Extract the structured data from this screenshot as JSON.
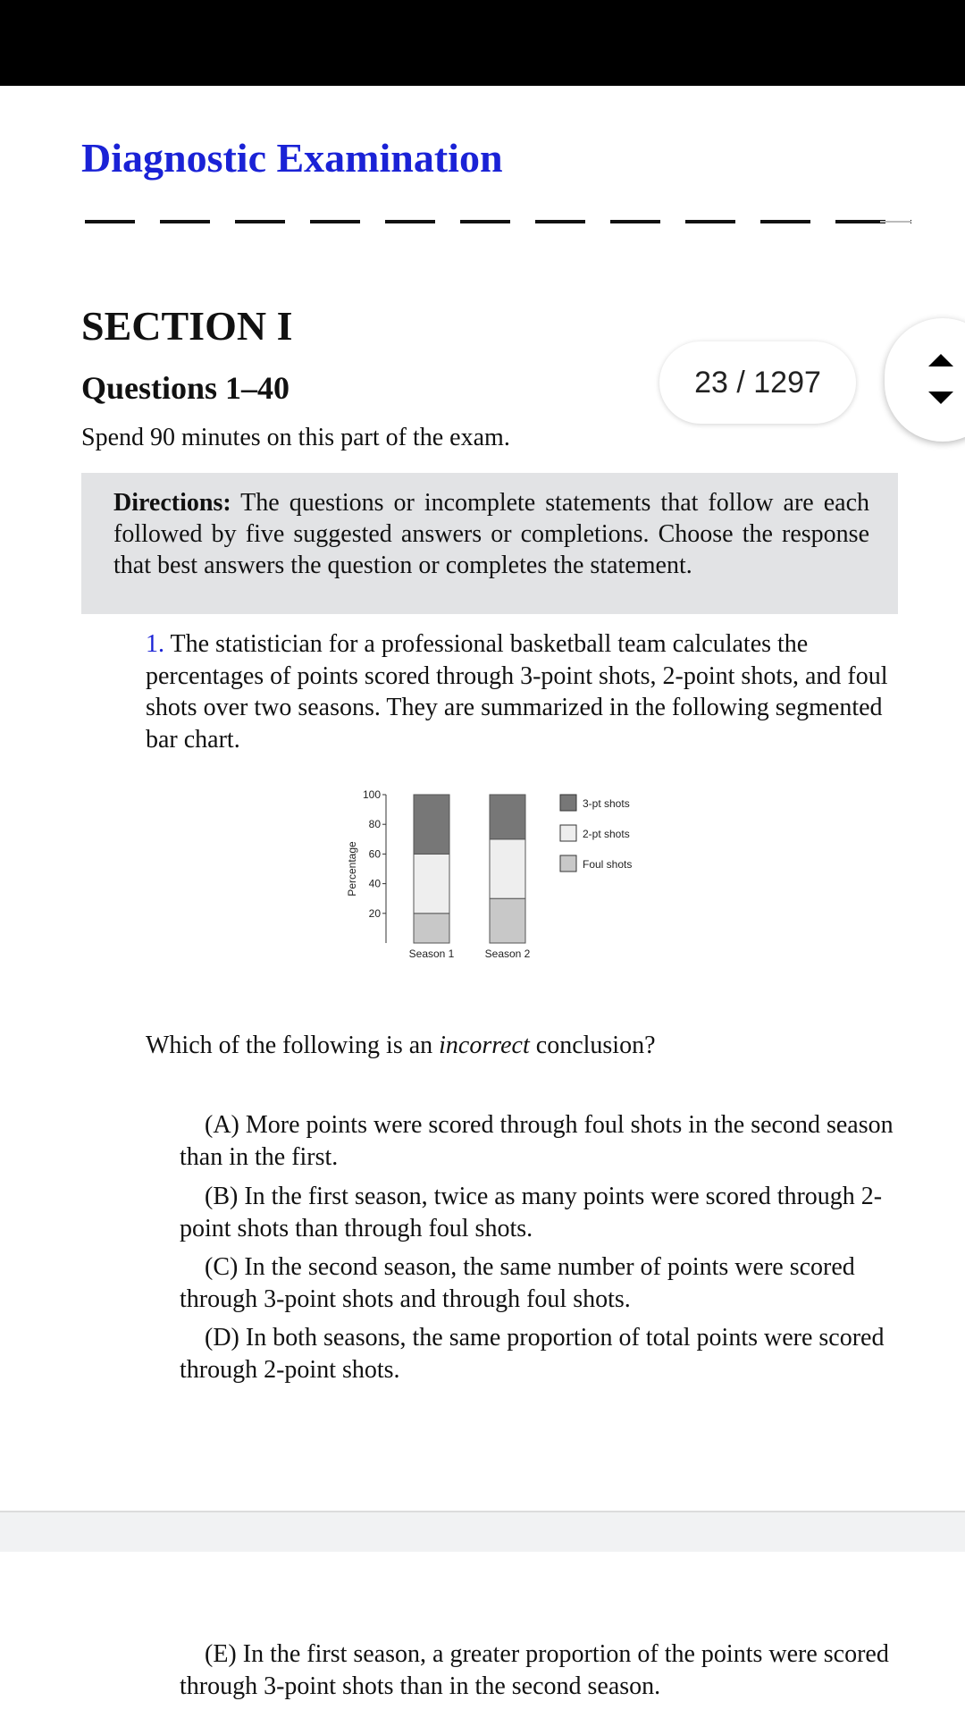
{
  "header": {
    "title": "Diagnostic Examination"
  },
  "section": {
    "heading": "SECTION I",
    "questions": "Questions 1–40",
    "time_note": "Spend 90 minutes on this part of the exam."
  },
  "pager": {
    "label": "23 / 1297"
  },
  "directions": {
    "lead": "Directions:",
    "text": " The questions or incomplete statements that follow are each followed by five suggested answers or completions. Choose the response that best answers the question or completes the statement."
  },
  "question1": {
    "number": "1.",
    "text": " The statistician for a professional basketball team calculates the percentages of points scored through 3-point shots, 2-point shots, and foul shots over two seasons. They are summarized in the following segmented bar chart.",
    "prompt_before": "Which of the following is an ",
    "prompt_italic": "incorrect",
    "prompt_after": " conclusion?",
    "choices": {
      "a": "(A) More points were scored through foul shots in the second season than in the first.",
      "b": "(B) In the first season, twice as many points were scored through 2-point shots than through foul shots.",
      "c": "(C) In the second season, the same number of points were scored through 3-point shots and through foul shots.",
      "d": "(D) In both seasons, the same proportion of total points were scored through 2-point shots.",
      "e": "(E) In the first season, a greater proportion of the points were scored through 3-point shots than in the second season."
    }
  },
  "chart_data": {
    "type": "bar",
    "stacked": true,
    "categories": [
      "Season 1",
      "Season 2"
    ],
    "series": [
      {
        "name": "Foul shots",
        "values": [
          20,
          30
        ],
        "color": "#c8c8c8"
      },
      {
        "name": "2-pt shots",
        "values": [
          40,
          40
        ],
        "color": "#eeeeee"
      },
      {
        "name": "3-pt shots",
        "values": [
          40,
          30
        ],
        "color": "#777777"
      }
    ],
    "ylabel": "Percentage",
    "yticks": [
      20,
      40,
      60,
      80,
      100
    ],
    "ylim": [
      0,
      100
    ],
    "legend": "right"
  }
}
